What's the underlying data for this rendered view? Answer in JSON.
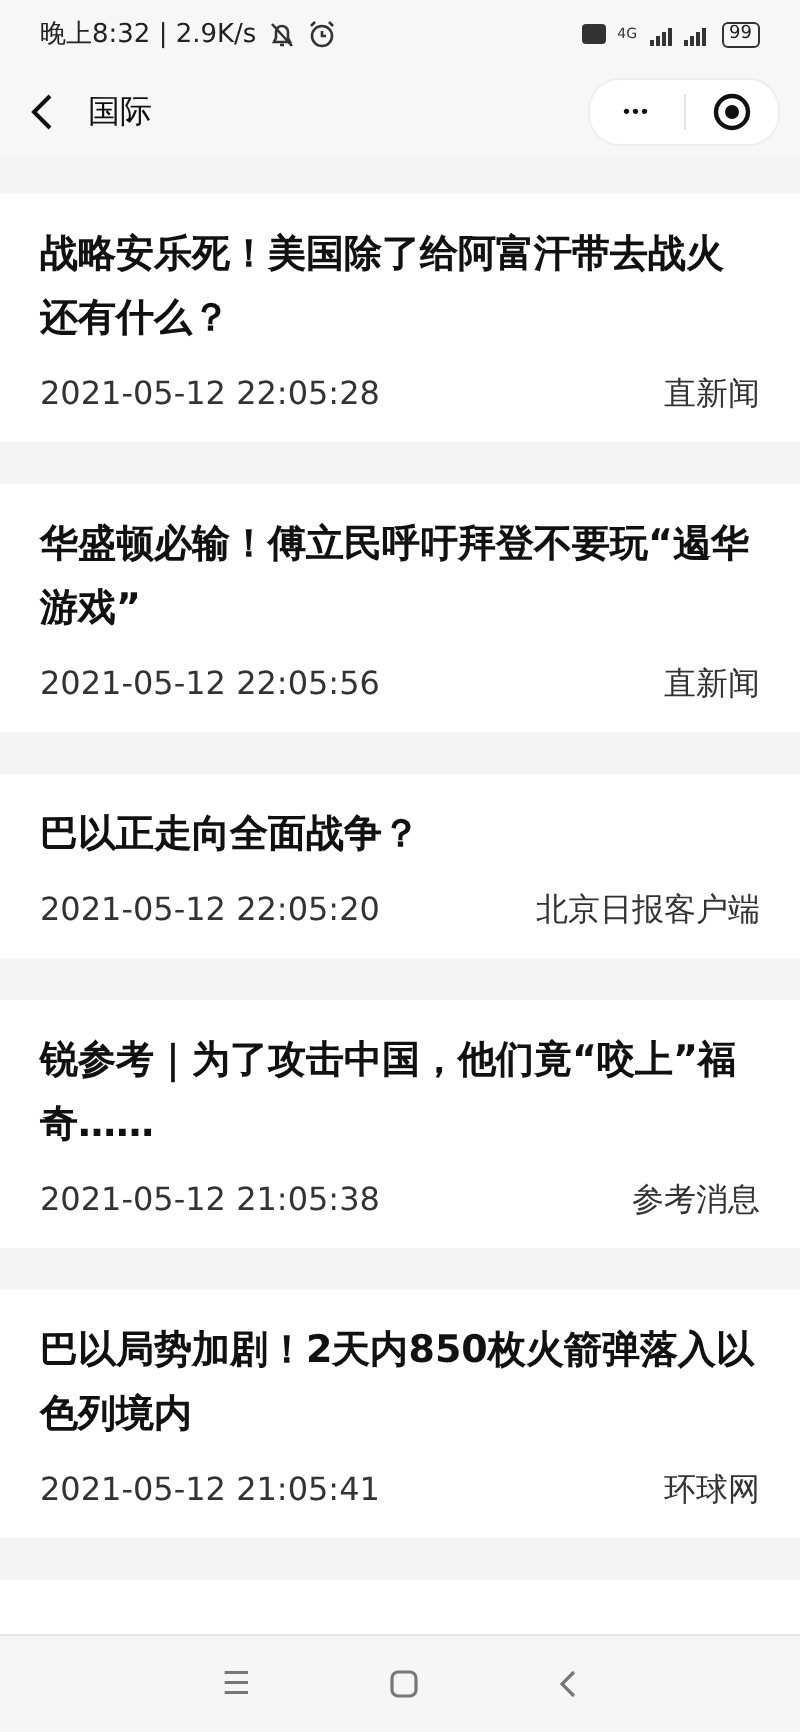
{
  "status_bar": {
    "time": "晚上8:32 | 2.9K/s",
    "network": "4G",
    "battery": "99"
  },
  "nav": {
    "title": "国际",
    "more": "•••"
  },
  "articles": [
    {
      "title": "战略安乐死！美国除了给阿富汗带去战火还有什么？",
      "time": "2021-05-12 22:05:28",
      "source": "直新闻"
    },
    {
      "title": "华盛顿必输！傅立民呼吁拜登不要玩“遏华游戏”",
      "time": "2021-05-12 22:05:56",
      "source": "直新闻"
    },
    {
      "title": "巴以正走向全面战争？",
      "time": "2021-05-12 22:05:20",
      "source": "北京日报客户端"
    },
    {
      "title": "锐参考｜为了攻击中国，他们竟“咬上”福奇……",
      "time": "2021-05-12 21:05:38",
      "source": "参考消息"
    },
    {
      "title": "巴以局势加剧！2天内850枚火箭弹落入以色列境内",
      "time": "2021-05-12 21:05:41",
      "source": "环球网"
    }
  ],
  "system_nav": {
    "menu": "☰"
  }
}
